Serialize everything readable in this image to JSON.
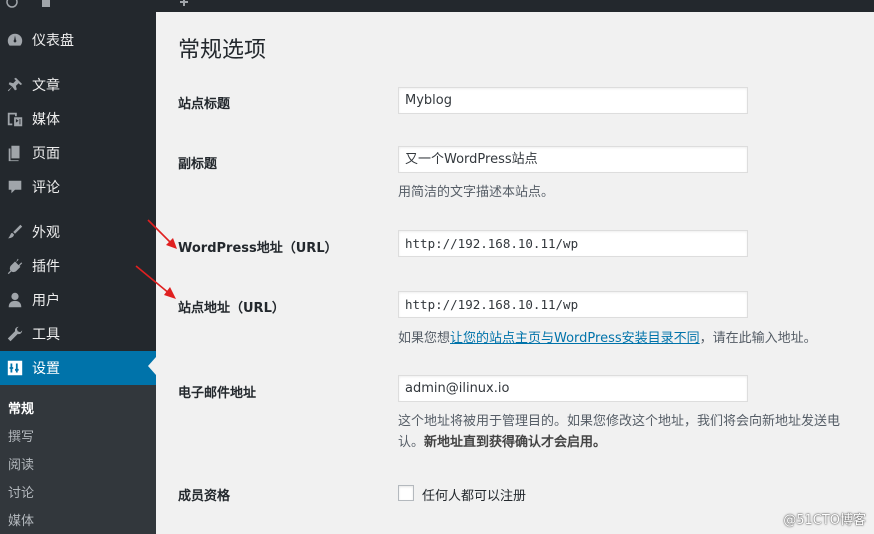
{
  "topbar": {
    "items": [
      "wp-logo-icon",
      "home-icon",
      "plus-icon"
    ]
  },
  "sidebar": {
    "items": [
      {
        "label": "仪表盘",
        "icon": "dashboard-icon"
      },
      {
        "label": "文章",
        "icon": "pin-icon"
      },
      {
        "label": "媒体",
        "icon": "media-icon"
      },
      {
        "label": "页面",
        "icon": "page-icon"
      },
      {
        "label": "评论",
        "icon": "comment-icon"
      },
      {
        "label": "外观",
        "icon": "brush-icon"
      },
      {
        "label": "插件",
        "icon": "plugin-icon"
      },
      {
        "label": "用户",
        "icon": "user-icon"
      },
      {
        "label": "工具",
        "icon": "wrench-icon"
      },
      {
        "label": "设置",
        "icon": "settings-icon",
        "current": true
      }
    ],
    "submenu": [
      {
        "label": "常规",
        "current": true
      },
      {
        "label": "撰写"
      },
      {
        "label": "阅读"
      },
      {
        "label": "讨论"
      },
      {
        "label": "媒体"
      }
    ],
    "accent_color": "#0073aa"
  },
  "main": {
    "title": "常规选项",
    "fields": {
      "site_title": {
        "label": "站点标题",
        "value": "Myblog"
      },
      "tagline": {
        "label": "副标题",
        "value": "又一个WordPress站点",
        "description": "用简洁的文字描述本站点。"
      },
      "wp_address": {
        "label": "WordPress地址（URL）",
        "value": "http://192.168.10.11/wp"
      },
      "site_address": {
        "label": "站点地址（URL）",
        "value": "http://192.168.10.11/wp",
        "description_prefix": "如果您想",
        "description_link": "让您的站点主页与WordPress安装目录不同",
        "description_suffix": "，请在此输入地址。"
      },
      "email": {
        "label": "电子邮件地址",
        "value": "admin@ilinux.io",
        "description_line1": "这个地址将被用于管理目的。如果您修改这个地址，我们将会向新地址发送电",
        "description_line2_plain": "认。",
        "description_line2_bold": "新地址直到获得确认才会启用。"
      },
      "membership": {
        "label": "成员资格",
        "checkbox_label": "任何人都可以注册",
        "checked": false
      }
    }
  },
  "watermark": "@51CTO博客",
  "annotation_color": "#e02020"
}
